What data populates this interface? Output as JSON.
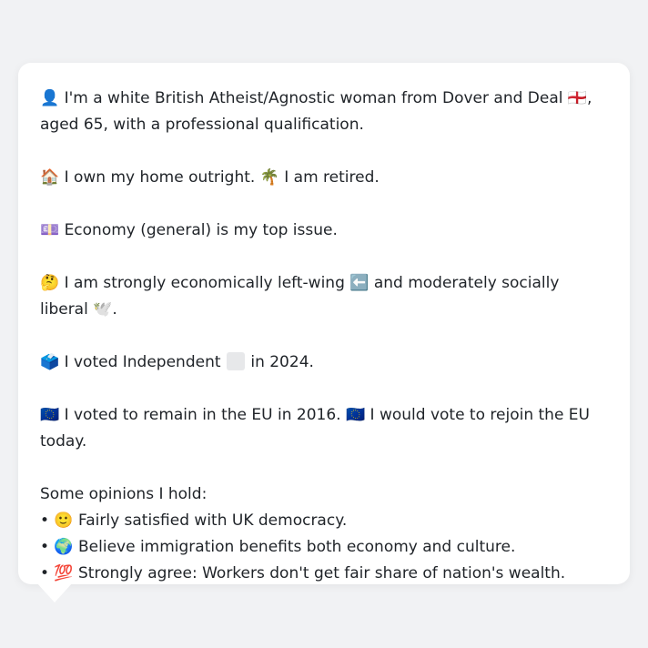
{
  "profile": {
    "intro": "👤 I'm a white British Atheist/Agnostic woman from Dover and Deal 🏴󠁧󠁢󠁥󠁮󠁧󠁿, aged 65, with a professional qualification.",
    "housing": "🏠 I own my home outright. 🌴 I am retired.",
    "top_issue": "💷 Economy (general) is my top issue.",
    "politics": "🤔 I am strongly economically left-wing ⬅️ and moderately socially liberal 🕊️.",
    "vote_2024_prefix": "🗳️ I voted Independent",
    "vote_2024_suffix": "in 2024.",
    "eu": "🇪🇺 I voted to remain in the EU in 2016. 🇪🇺 I would vote to rejoin the EU today.",
    "opinions_title": "Some opinions I hold:",
    "opinions": [
      "• 🙂 Fairly satisfied with UK democracy.",
      "• 🌍 Believe immigration benefits both economy and culture.",
      "• 💯 Strongly agree: Workers don't get fair share of nation's wealth."
    ]
  },
  "colors": {
    "background": "#f1f2f4",
    "card": "#ffffff",
    "text": "#1f2328",
    "independent_swatch": "#e7e8ea"
  }
}
